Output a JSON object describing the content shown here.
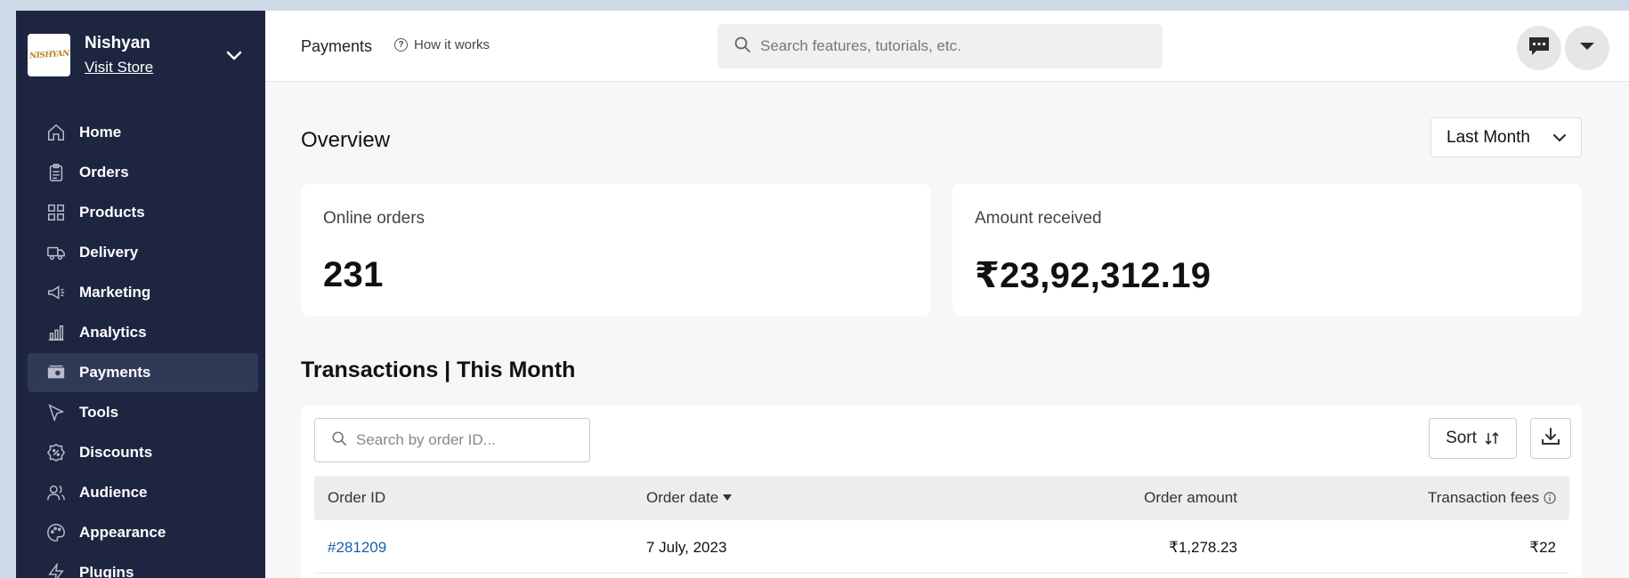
{
  "store": {
    "logo_text": "NISHYAN",
    "name": "Nishyan",
    "visit_link": "Visit Store"
  },
  "sidebar": {
    "items": [
      {
        "label": "Home",
        "icon": "home-icon"
      },
      {
        "label": "Orders",
        "icon": "clipboard-icon"
      },
      {
        "label": "Products",
        "icon": "grid-icon"
      },
      {
        "label": "Delivery",
        "icon": "truck-icon"
      },
      {
        "label": "Marketing",
        "icon": "megaphone-icon"
      },
      {
        "label": "Analytics",
        "icon": "bar-chart-icon"
      },
      {
        "label": "Payments",
        "icon": "money-icon",
        "active": true
      },
      {
        "label": "Tools",
        "icon": "cursor-icon"
      },
      {
        "label": "Discounts",
        "icon": "discount-badge-icon"
      },
      {
        "label": "Audience",
        "icon": "users-icon"
      },
      {
        "label": "Appearance",
        "icon": "palette-icon"
      },
      {
        "label": "Plugins",
        "icon": "lightning-icon"
      }
    ]
  },
  "header": {
    "title": "Payments",
    "how_it_works": "How it works",
    "search_placeholder": "Search features, tutorials, etc."
  },
  "overview": {
    "title": "Overview",
    "range": "Last Month",
    "online_orders_label": "Online orders",
    "online_orders_value": "231",
    "amount_label": "Amount received",
    "amount_value": "₹23,92,312.19"
  },
  "transactions": {
    "title": "Transactions | This Month",
    "search_placeholder": "Search by order ID...",
    "sort_label": "Sort",
    "columns": {
      "order_id": "Order ID",
      "order_date": "Order date",
      "order_amount": "Order amount",
      "fees": "Transaction fees"
    },
    "rows": [
      {
        "order_id": "#281209",
        "order_date": "7 July, 2023",
        "order_amount": "₹1,278.23",
        "fees": "₹22"
      }
    ]
  },
  "colors": {
    "sidebar_bg": "#1e2541",
    "active_item_bg": "#2f3a56",
    "link": "#1a5fa8",
    "page_bg": "#f7f7f7"
  }
}
